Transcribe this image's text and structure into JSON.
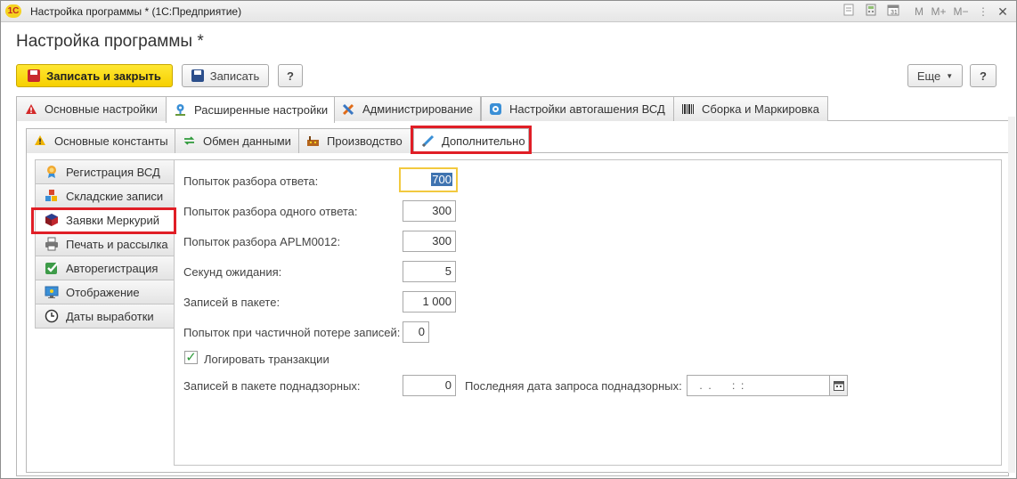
{
  "window": {
    "logo": "1С",
    "title": "Настройка программы * (1С:Предприятие)",
    "controls": [
      "M",
      "M+",
      "M−"
    ]
  },
  "page_title": "Настройка программы *",
  "toolbar": {
    "save_close_label": "Записать и закрыть",
    "save_label": "Записать",
    "help_label": "?",
    "more_label": "Еще",
    "help2_label": "?"
  },
  "tabs": [
    {
      "label": "Основные настройки",
      "icon": "warning-icon"
    },
    {
      "label": "Расширенные настройки",
      "icon": "settings-node-icon",
      "active": true
    },
    {
      "label": "Администрирование",
      "icon": "tools-icon"
    },
    {
      "label": "Настройки автогашения ВСД",
      "icon": "auto-settings-icon"
    },
    {
      "label": "Сборка и Маркировка",
      "icon": "barcode-icon"
    }
  ],
  "subtabs": [
    {
      "label": "Основные константы",
      "icon": "warning-icon"
    },
    {
      "label": "Обмен данными",
      "icon": "sync-icon"
    },
    {
      "label": "Производство",
      "icon": "factory-icon"
    },
    {
      "label": "Дополнительно",
      "icon": "pen-icon",
      "active": true
    }
  ],
  "nav": [
    {
      "label": "Регистрация ВСД",
      "icon": "certificate-icon"
    },
    {
      "label": "Складские записи",
      "icon": "blocks-icon"
    },
    {
      "label": "Заявки Меркурий",
      "icon": "cube-icon",
      "active": true
    },
    {
      "label": "Печать и рассылка",
      "icon": "printer-icon"
    },
    {
      "label": "Авторегистрация",
      "icon": "green-check-icon"
    },
    {
      "label": "Отображение",
      "icon": "monitor-icon"
    },
    {
      "label": "Даты выработки",
      "icon": "clock-icon"
    }
  ],
  "fields": {
    "parse_attempts": {
      "label": "Попыток разбора ответа:",
      "value": "700"
    },
    "parse_single": {
      "label": "Попыток разбора одного ответа:",
      "value": "300"
    },
    "parse_aplm": {
      "label": "Попыток разбора APLM0012:",
      "value": "300"
    },
    "wait_seconds": {
      "label": "Секунд ожидания:",
      "value": "5"
    },
    "batch_records": {
      "label": "Записей в пакете:",
      "value": "1 000"
    },
    "partial_loss": {
      "label": "Попыток при частичной потере записей:",
      "value": "0"
    },
    "log_transactions": {
      "label": "Логировать транзакции",
      "checked": true
    },
    "supervised_batch": {
      "label": "Записей в пакете поднадзорных:",
      "value": "0"
    },
    "last_request_date": {
      "label": "Последняя дата запроса поднадзорных:",
      "value": " .  .       :  :"
    }
  },
  "colors": {
    "primary_button": "#f6d000",
    "highlight": "#e01e26",
    "focus_border": "#f2c93f"
  }
}
